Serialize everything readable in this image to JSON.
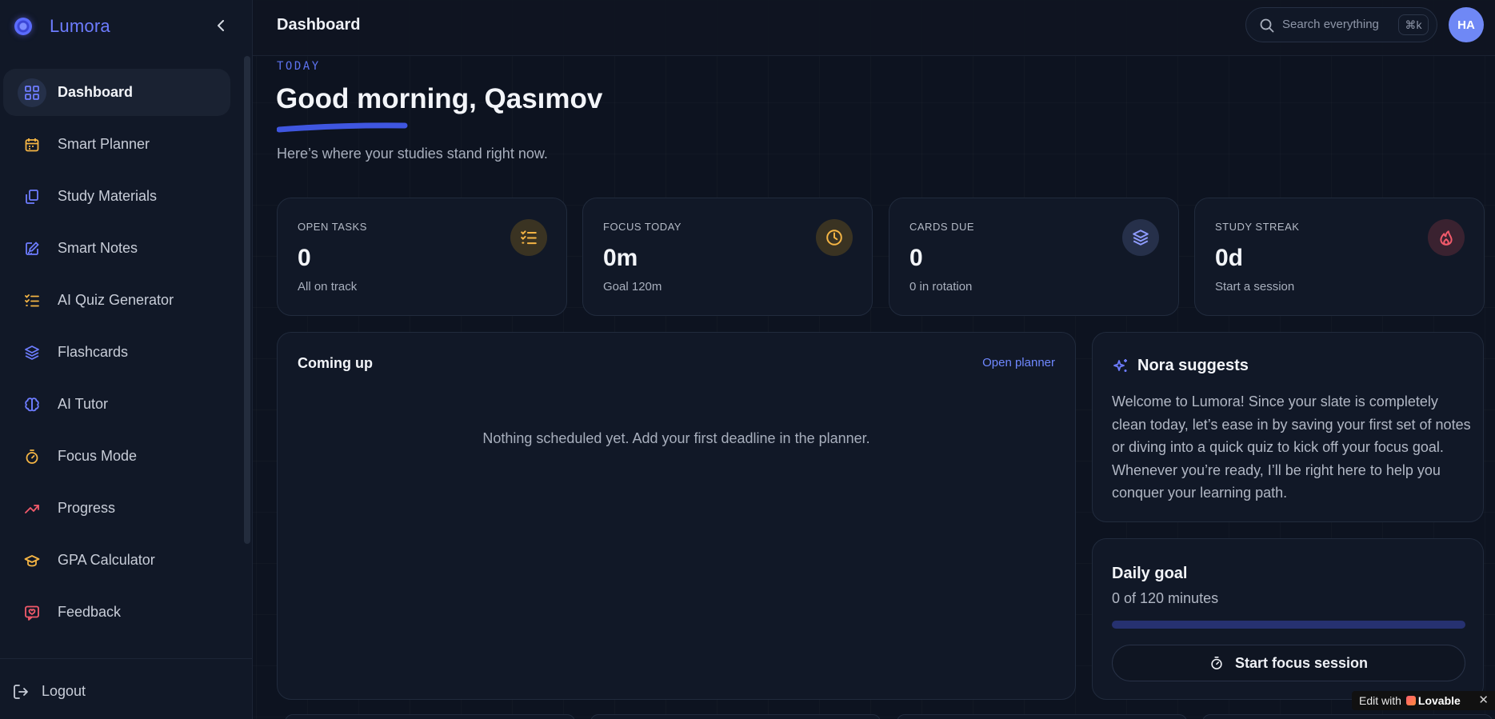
{
  "app": {
    "name": "Lumora"
  },
  "sidebar": {
    "items": [
      {
        "label": "Dashboard",
        "icon": "dashboard-grid-icon",
        "color": "#6d7cff",
        "active": true
      },
      {
        "label": "Smart Planner",
        "icon": "calendar-icon",
        "color": "#f5b544"
      },
      {
        "label": "Study Materials",
        "icon": "files-icon",
        "color": "#6d7cff"
      },
      {
        "label": "Smart Notes",
        "icon": "edit-note-icon",
        "color": "#6d7cff"
      },
      {
        "label": "AI Quiz Generator",
        "icon": "checklist-icon",
        "color": "#f5b544"
      },
      {
        "label": "Flashcards",
        "icon": "layers-icon",
        "color": "#6d7cff"
      },
      {
        "label": "AI Tutor",
        "icon": "brain-icon",
        "color": "#6d7cff"
      },
      {
        "label": "Focus Mode",
        "icon": "timer-icon",
        "color": "#f5b544"
      },
      {
        "label": "Progress",
        "icon": "trending-up-icon",
        "color": "#f25a6b"
      },
      {
        "label": "GPA Calculator",
        "icon": "graduation-cap-icon",
        "color": "#f5b544"
      },
      {
        "label": "Feedback",
        "icon": "heart-message-icon",
        "color": "#f25a6b"
      }
    ],
    "logout_label": "Logout"
  },
  "header": {
    "title": "Dashboard",
    "search_placeholder": "Search everything",
    "search_shortcut": "⌘k",
    "avatar_initials": "HA"
  },
  "greeting": {
    "eyebrow": "TODAY",
    "title": "Good morning, Qasımov",
    "subtitle": "Here’s where your studies stand right now."
  },
  "stats": [
    {
      "label": "OPEN TASKS",
      "value": "0",
      "sub": "All on track",
      "icon": "checklist-icon",
      "color": "#f5b544"
    },
    {
      "label": "FOCUS TODAY",
      "value": "0m",
      "sub": "Goal 120m",
      "icon": "clock-icon",
      "color": "#f5b544"
    },
    {
      "label": "CARDS DUE",
      "value": "0",
      "sub": "0 in rotation",
      "icon": "layers-icon",
      "color": "#8f9cff"
    },
    {
      "label": "STUDY STREAK",
      "value": "0d",
      "sub": "Start a session",
      "icon": "flame-icon",
      "color": "#f25a6b"
    }
  ],
  "coming_up": {
    "title": "Coming up",
    "link": "Open planner",
    "empty": "Nothing scheduled yet. Add your first deadline in the planner."
  },
  "nora": {
    "title": "Nora suggests",
    "body": "Welcome to Lumora! Since your slate is completely clean today, let’s ease in by saving your first set of notes or diving into a quick quiz to kick off your focus goal. Whenever you’re ready, I’ll be right here to help you conquer your learning path."
  },
  "daily_goal": {
    "title": "Daily goal",
    "sub": "0 of 120 minutes",
    "progress": 0,
    "button": "Start focus session"
  },
  "badge": {
    "text": "Edit with",
    "brand": "Lovable",
    "close": "✕"
  }
}
